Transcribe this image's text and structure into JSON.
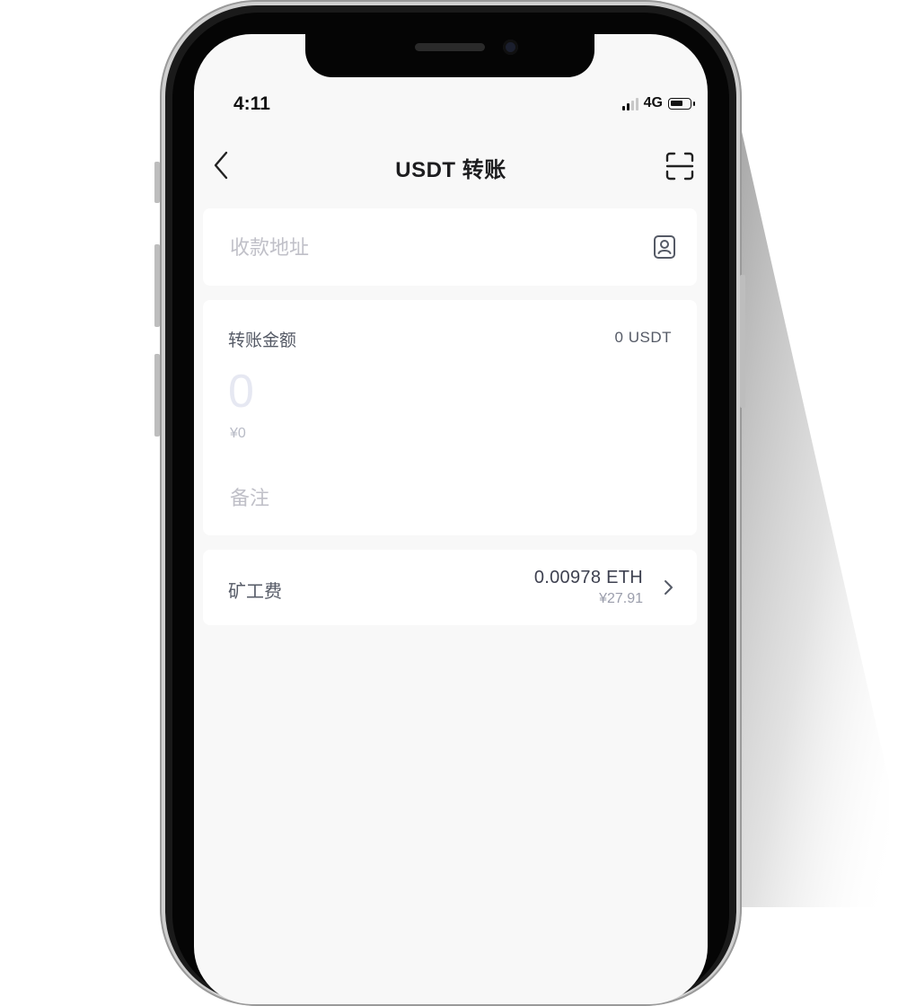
{
  "status_bar": {
    "time": "4:11",
    "network": "4G",
    "battery_level": 0.7,
    "signal_bars": 2
  },
  "nav": {
    "title": "USDT 转账",
    "back_icon": "chevron-left-icon",
    "scan_icon": "scan-icon"
  },
  "address": {
    "placeholder": "收款地址",
    "contact_icon": "address-book-icon"
  },
  "amount": {
    "label": "转账金额",
    "balance": "0 USDT",
    "placeholder": "0",
    "fiat_value": "¥0",
    "memo_placeholder": "备注"
  },
  "fee": {
    "label": "矿工费",
    "eth_amount": "0.00978 ETH",
    "fiat_amount": "¥27.91",
    "chevron_icon": "chevron-right-icon"
  },
  "colors": {
    "screen_background": "#f8f8f8",
    "card_background": "#ffffff",
    "title_text": "#1d1d1f",
    "placeholder_text": "#c0c0c8"
  }
}
